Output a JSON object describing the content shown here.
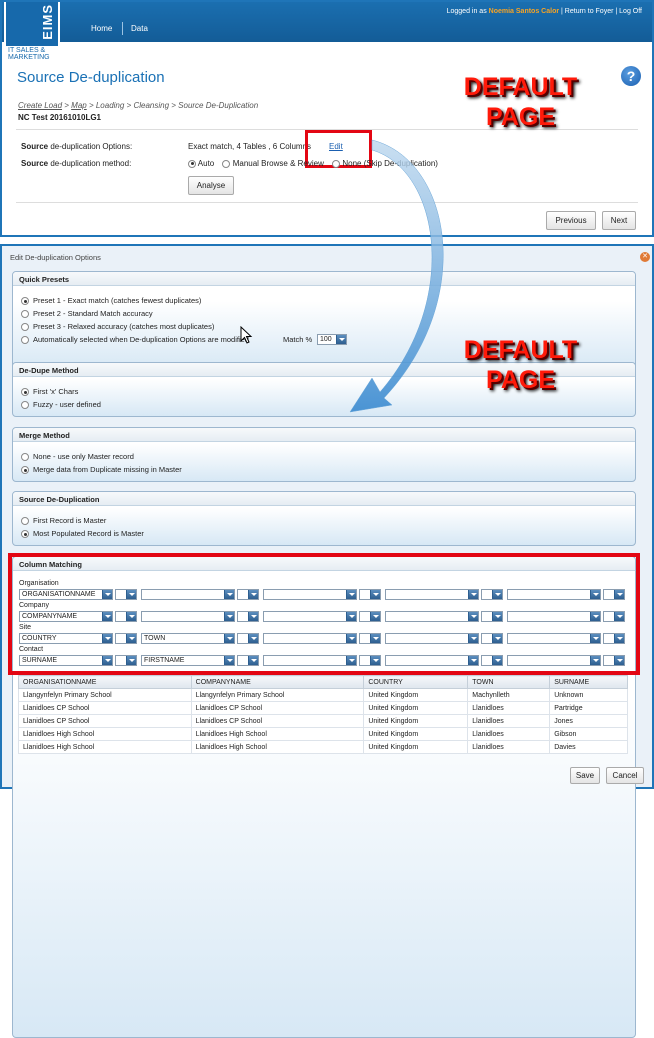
{
  "header": {
    "logo": {
      "brand": "EIMS",
      "tagline_line1": "IT SALES &",
      "tagline_line2": "MARKETING"
    },
    "nav": [
      "Home",
      "Data"
    ],
    "logged_in_prefix": "Logged in as",
    "user_name": "Noemia Santos Calor",
    "links": [
      "Return to Foyer",
      "Log Off"
    ]
  },
  "page": {
    "title": "Source De-duplication",
    "breadcrumb": [
      "Create Load",
      "Map",
      "Loading",
      "Cleansing",
      "Source De-Duplication"
    ],
    "load_name": "NC Test 20161010LG1",
    "options_label_bold": "Source",
    "options_label_rest": " de-duplication Options:",
    "options_value": "Exact match, 4 Tables , 6 Columns",
    "edit_link": "Edit",
    "method_label_bold": "Source",
    "method_label_rest": " de-duplication method:",
    "methods": [
      {
        "label": "Auto",
        "selected": true
      },
      {
        "label": "Manual Browse & Review",
        "selected": false
      },
      {
        "label": "None (Skip De-duplication)",
        "selected": false
      }
    ],
    "analyse_button": "Analyse",
    "previous_button": "Previous",
    "next_button": "Next"
  },
  "annotations": {
    "line1": "DEFAULT",
    "line2": "PAGE"
  },
  "dialog": {
    "title": "Edit De-duplication Options",
    "quick_presets": {
      "heading": "Quick Presets",
      "options": [
        {
          "label": "Preset 1 - Exact match (catches fewest duplicates)",
          "selected": true
        },
        {
          "label": "Preset 2 - Standard Match accuracy",
          "selected": false
        },
        {
          "label": "Preset 3 - Relaxed accuracy (catches most duplicates)",
          "selected": false
        },
        {
          "label": "Automatically selected when De-duplication Options are modified",
          "selected": false
        }
      ],
      "match_label": "Match %",
      "match_value": "100"
    },
    "dedupe_method": {
      "heading": "De-Dupe Method",
      "options": [
        {
          "label": "First 'x' Chars",
          "selected": true
        },
        {
          "label": "Fuzzy - user defined",
          "selected": false
        }
      ]
    },
    "merge_method": {
      "heading": "Merge Method",
      "options": [
        {
          "label": "None - use only Master record",
          "selected": false
        },
        {
          "label": "Merge data from Duplicate missing in Master",
          "selected": true
        }
      ]
    },
    "source_dedup": {
      "heading": "Source De-Duplication",
      "options": [
        {
          "label": "First Record is Master",
          "selected": false
        },
        {
          "label": "Most Populated Record is Master",
          "selected": true
        }
      ]
    },
    "column_matching": {
      "heading": "Column Matching",
      "groups": [
        {
          "name": "Organisation",
          "columns": [
            "ORGANISATIONNAME",
            "",
            "",
            "",
            ""
          ]
        },
        {
          "name": "Company",
          "columns": [
            "COMPANYNAME",
            "",
            "",
            "",
            ""
          ]
        },
        {
          "name": "Site",
          "columns": [
            "COUNTRY",
            "TOWN",
            "",
            "",
            ""
          ]
        },
        {
          "name": "Contact",
          "columns": [
            "SURNAME",
            "FIRSTNAME",
            "",
            "",
            ""
          ]
        }
      ]
    },
    "preview": {
      "headers": [
        "ORGANISATIONNAME",
        "COMPANYNAME",
        "COUNTRY",
        "TOWN",
        "SURNAME"
      ],
      "rows": [
        [
          "Llangynfelyn Primary School",
          "Llangynfelyn Primary School",
          "United Kingdom",
          "Machynlleth",
          "Unknown"
        ],
        [
          "Llanidloes CP School",
          "Llanidloes CP School",
          "United Kingdom",
          "Llanidloes",
          "Partridge"
        ],
        [
          "Llanidloes CP School",
          "Llanidloes CP School",
          "United Kingdom",
          "Llanidloes",
          "Jones"
        ],
        [
          "Llanidloes High School",
          "Llanidloes High School",
          "United Kingdom",
          "Llanidloes",
          "Gibson"
        ],
        [
          "Llanidloes High School",
          "Llanidloes High School",
          "United Kingdom",
          "Llanidloes",
          "Davies"
        ]
      ]
    },
    "save_button": "Save",
    "cancel_button": "Cancel"
  }
}
